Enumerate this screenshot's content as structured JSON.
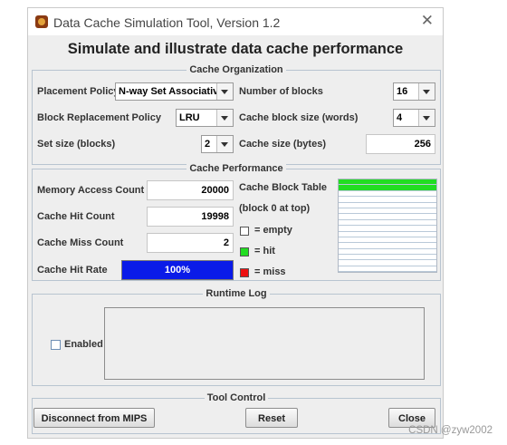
{
  "window": {
    "title": "Data Cache Simulation Tool, Version 1.2",
    "heading": "Simulate and illustrate data cache performance"
  },
  "organization": {
    "legend": "Cache Organization",
    "placement_label": "Placement Policy",
    "placement_value": "N-way Set Associative",
    "replacement_label": "Block Replacement Policy",
    "replacement_value": "LRU",
    "set_size_label": "Set size (blocks)",
    "set_size_value": "2",
    "num_blocks_label": "Number of blocks",
    "num_blocks_value": "16",
    "block_size_label": "Cache block size (words)",
    "block_size_value": "4",
    "cache_size_label": "Cache size (bytes)",
    "cache_size_value": "256"
  },
  "performance": {
    "legend": "Cache Performance",
    "access_label": "Memory Access Count",
    "access_value": "20000",
    "hit_label": "Cache Hit Count",
    "hit_value": "19998",
    "miss_label": "Cache Miss Count",
    "miss_value": "2",
    "rate_label": "Cache Hit Rate",
    "rate_value": "100%",
    "rate_fraction": 1.0,
    "table_label": "Cache Block Table",
    "table_sublabel": "(block 0 at top)",
    "legend_empty": "= empty",
    "legend_hit": "= hit",
    "legend_miss": "= miss",
    "colors": {
      "empty": "#ffffff",
      "hit": "#22dd22",
      "miss": "#ee1111"
    },
    "blocks": [
      "hit",
      "hit",
      "empty",
      "empty",
      "empty",
      "empty",
      "empty",
      "empty",
      "empty",
      "empty",
      "empty",
      "empty",
      "empty",
      "empty",
      "empty",
      "empty"
    ]
  },
  "log": {
    "legend": "Runtime Log",
    "enabled_label": "Enabled",
    "enabled": false
  },
  "control": {
    "legend": "Tool Control",
    "disconnect_label": "Disconnect from MIPS",
    "reset_label": "Reset",
    "close_label": "Close"
  },
  "watermark": "CSDN @zyw2002"
}
